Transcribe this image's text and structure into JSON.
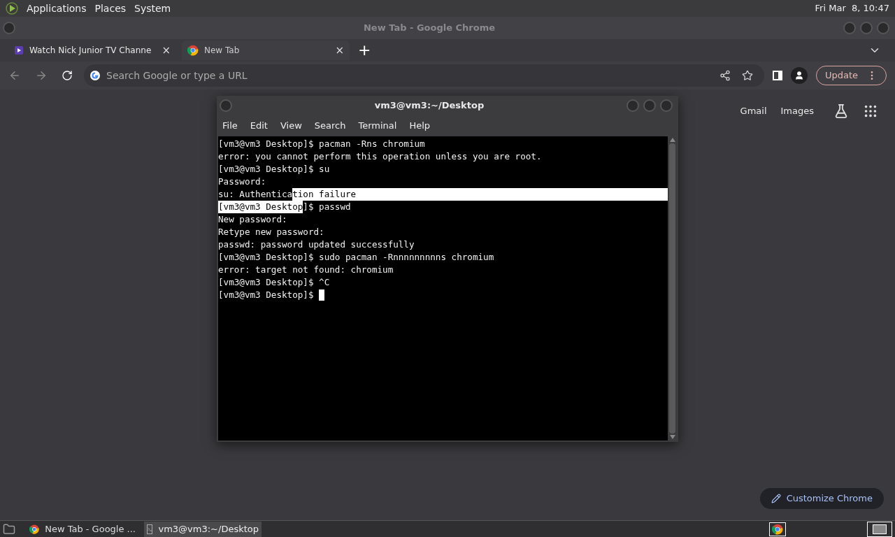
{
  "top_panel": {
    "menus": [
      "Applications",
      "Places",
      "System"
    ],
    "clock": "Fri Mar  8, 10:47"
  },
  "window": {
    "title": "New Tab - Google Chrome"
  },
  "tabs": [
    {
      "label": "Watch Nick Junior TV Channe",
      "selected": false,
      "close": "×"
    },
    {
      "label": "New Tab",
      "selected": true,
      "close": "×"
    }
  ],
  "new_tab": "+",
  "omnibox": {
    "placeholder": "Search Google or type a URL"
  },
  "update_button": "Update",
  "page_links": [
    "Gmail",
    "Images"
  ],
  "customize_button": "Customize Chrome",
  "terminal": {
    "title": "vm3@vm3:~/Desktop",
    "menus": [
      "File",
      "Edit",
      "View",
      "Search",
      "Terminal",
      "Help"
    ],
    "lines": [
      [
        {
          "text": "[vm3@vm3 Desktop]$ pacman -Rns chromium",
          "selected": false
        }
      ],
      [
        {
          "text": "error: you cannot perform this operation unless you are root.",
          "selected": false
        }
      ],
      [
        {
          "text": "[vm3@vm3 Desktop]$ su",
          "selected": false
        }
      ],
      [
        {
          "text": "Password:",
          "selected": false
        }
      ],
      [
        {
          "text": "su: Authentica",
          "selected": false
        },
        {
          "text": "tion failure",
          "selected": true
        }
      ],
      [
        {
          "text": "[vm3@vm3 Desktop",
          "selected": true
        },
        {
          "text": "]$ passwd",
          "selected": false
        }
      ],
      [
        {
          "text": "New password:",
          "selected": false
        }
      ],
      [
        {
          "text": "Retype new password:",
          "selected": false
        }
      ],
      [
        {
          "text": "passwd: password updated successfully",
          "selected": false
        }
      ],
      [
        {
          "text": "[vm3@vm3 Desktop]$ sudo pacman -Rnnnnnnnnns chromium",
          "selected": false
        }
      ],
      [
        {
          "text": "error: target not found: chromium",
          "selected": false
        }
      ],
      [
        {
          "text": "[vm3@vm3 Desktop]$ ^C",
          "selected": false
        }
      ],
      [
        {
          "text": "[vm3@vm3 Desktop]$ ",
          "selected": false
        }
      ]
    ],
    "cursor": true
  },
  "taskbar": [
    {
      "label": "New Tab - Google ...",
      "selected": false,
      "kind": "browser"
    },
    {
      "label": "vm3@vm3:~/Desktop",
      "selected": true,
      "kind": "terminal"
    }
  ]
}
